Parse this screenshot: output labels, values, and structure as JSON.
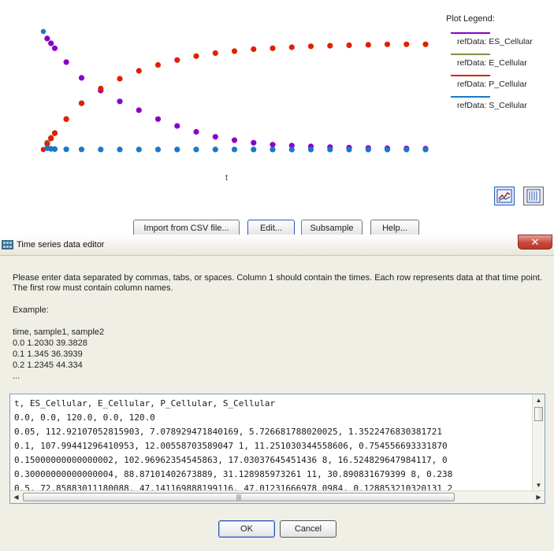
{
  "plot": {
    "xlabel": "t",
    "legend_title": "Plot Legend:",
    "toolbar": {
      "chart_view_icon": "chart-icon",
      "table_view_icon": "table-icon"
    }
  },
  "chart_data": {
    "type": "scatter",
    "title": "",
    "xlabel": "t",
    "ylabel": "",
    "legend_placement": "right",
    "series": [
      {
        "name": "refData: ES_Cellular",
        "color": "#8b00c9",
        "x": [
          0.0,
          0.05,
          0.1,
          0.15,
          0.3,
          0.5,
          0.75,
          1.0,
          1.25,
          1.5,
          1.75,
          2.0,
          2.25,
          2.5,
          2.75,
          3.0,
          3.25,
          3.5,
          3.75,
          4.0,
          4.25,
          4.5,
          4.75,
          5.0
        ],
        "y": [
          0.0,
          112.9,
          107.99,
          102.97,
          88.87,
          72.86,
          60.0,
          49.0,
          40.0,
          31.0,
          24.0,
          18.0,
          13.0,
          9.5,
          7.0,
          5.0,
          4.0,
          3.2,
          2.5,
          2.0,
          1.6,
          1.3,
          1.1,
          0.9
        ]
      },
      {
        "name": "refData: E_Cellular",
        "color": "#8c8c4a",
        "x": [
          0.0,
          0.05,
          0.1,
          0.15,
          0.3,
          0.5
        ],
        "y": [
          120.0,
          7.08,
          12.0,
          17.0,
          31.13,
          47.14
        ]
      },
      {
        "name": "refData: P_Cellular",
        "color": "#e02000",
        "x": [
          0.0,
          0.05,
          0.1,
          0.15,
          0.3,
          0.5,
          0.75,
          1.0,
          1.25,
          1.5,
          1.75,
          2.0,
          2.25,
          2.5,
          2.75,
          3.0,
          3.25,
          3.5,
          3.75,
          4.0,
          4.25,
          4.5,
          4.75,
          5.0
        ],
        "y": [
          0.0,
          5.73,
          11.25,
          16.52,
          30.89,
          47.01,
          62.0,
          72.0,
          80.0,
          86.0,
          91.0,
          95.0,
          98.0,
          100.0,
          102.0,
          103.0,
          104.0,
          105.0,
          105.5,
          106.0,
          106.5,
          107.0,
          107.0,
          107.0
        ]
      },
      {
        "name": "refData: S_Cellular",
        "color": "#1a78c8",
        "x": [
          0.0,
          0.05,
          0.1,
          0.15,
          0.3,
          0.5,
          0.75,
          1.0,
          1.25,
          1.5,
          1.75,
          2.0,
          2.25,
          2.5,
          2.75,
          3.0,
          3.25,
          3.5,
          3.75,
          4.0,
          4.25,
          4.5,
          4.75,
          5.0
        ],
        "y": [
          120.0,
          1.35,
          0.75,
          0.45,
          0.24,
          0.13,
          0.1,
          0.08,
          0.07,
          0.06,
          0.05,
          0.05,
          0.04,
          0.04,
          0.04,
          0.03,
          0.03,
          0.03,
          0.03,
          0.03,
          0.03,
          0.03,
          0.03,
          0.03
        ]
      }
    ]
  },
  "buttons": {
    "import_label": "Import from CSV file...",
    "edit_label": "Edit...",
    "subsample_label": "Subsample",
    "help_label": "Help..."
  },
  "dialog": {
    "title": "Time series data editor",
    "close_glyph": "✕",
    "instructions_line1": "Please enter data separated by commas, tabs, or spaces. Column 1 should contain the times. Each row represents data at that time point.",
    "instructions_line2": "The first row must contain column names.",
    "example_label": "Example:",
    "example_lines": [
      "time, sample1, sample2",
      "0.0 1.2030 39.3828",
      "0.1 1.345 36.3939",
      "0.2 1.2345 44.334",
      "..."
    ],
    "textarea_lines": [
      "t, ES_Cellular, E_Cellular, P_Cellular, S_Cellular",
      "0.0, 0.0, 120.0, 0.0, 120.0",
      "0.05, 112.92107052815903, 7.078929471840169, 5.726681788020025, 1.3522476830381721",
      "0.1, 107.99441296410953, 12.00558703589047 1, 11.251030344558606, 0.754556693331870",
      "0.15000000000000002, 102.96962354545863, 17.03037645451436 8, 16.524829647984117, 0",
      "0.30000000000000004, 88.87101402673889, 31.128985973261 11, 30.890831679399 8, 0.238",
      "0.5, 72.85883011180088, 47.141169888199116, 47.01231666978 0984, 0.128853210320131 2"
    ],
    "ok_label": "OK",
    "cancel_label": "Cancel"
  }
}
